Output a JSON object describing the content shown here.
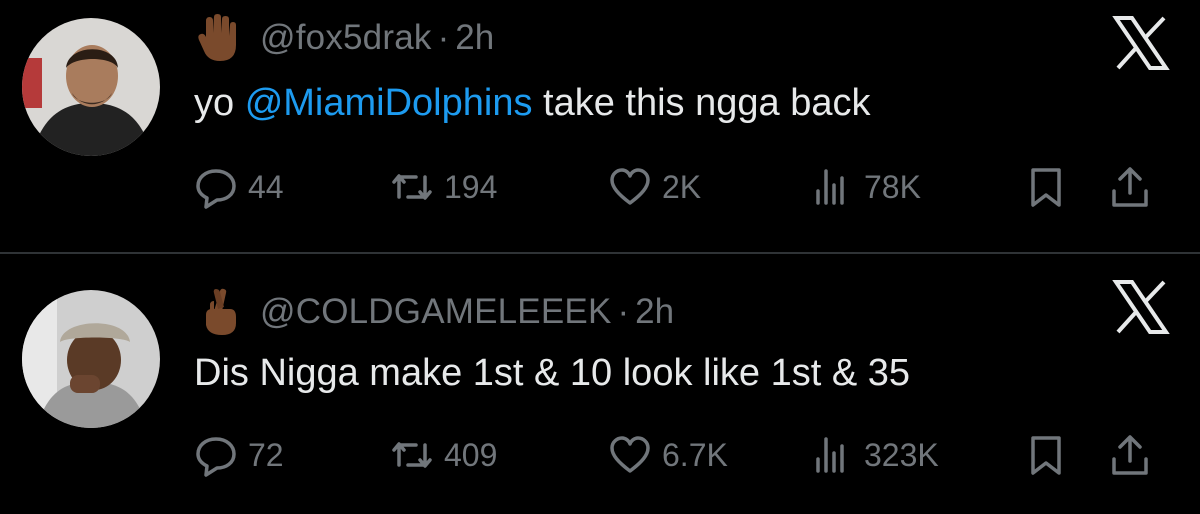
{
  "tweets": [
    {
      "emoji": "raised-hand-emoji",
      "handle": "@fox5drak",
      "dot": "·",
      "time": "2h",
      "text_before": "yo ",
      "mention": "@MiamiDolphins",
      "text_after": " take this ngga back",
      "replies": "44",
      "retweets": "194",
      "likes": "2K",
      "views": "78K"
    },
    {
      "emoji": "crossed-fingers-emoji",
      "handle": "@COLDGAMELEEEK",
      "dot": "·",
      "time": "2h",
      "text": "Dis Nigga make 1st & 10 look like 1st & 35",
      "replies": "72",
      "retweets": "409",
      "likes": "6.7K",
      "views": "323K"
    }
  ],
  "colors": {
    "background": "#000000",
    "text": "#e7e9ea",
    "muted": "#71767b",
    "link": "#1d9bf0",
    "divider": "#2f3336"
  }
}
